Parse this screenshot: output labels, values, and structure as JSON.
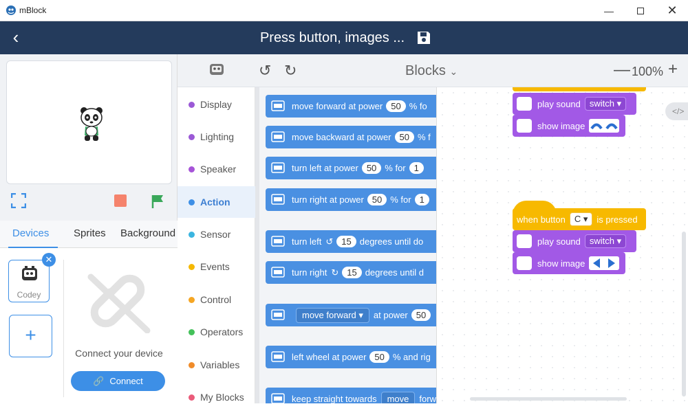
{
  "window": {
    "app_name": "mBlock"
  },
  "header": {
    "project_title": "Press button, images ..."
  },
  "stage_tabs": [
    "Devices",
    "Sprites",
    "Background"
  ],
  "device": {
    "name": "Codey"
  },
  "connect": {
    "prompt": "Connect your device",
    "button_label": "Connect"
  },
  "toolbar": {
    "mode_label": "Blocks",
    "zoom": "100%"
  },
  "categories": [
    {
      "label": "Display",
      "color": "#9b59d6"
    },
    {
      "label": "Lighting",
      "color": "#9b59d6"
    },
    {
      "label": "Speaker",
      "color": "#a654d8"
    },
    {
      "label": "Action",
      "color": "#3d8fe6",
      "active": true
    },
    {
      "label": "Sensor",
      "color": "#3bb5e0"
    },
    {
      "label": "Events",
      "color": "#f5b800"
    },
    {
      "label": "Control",
      "color": "#f5a623"
    },
    {
      "label": "Operators",
      "color": "#44c15a"
    },
    {
      "label": "Variables",
      "color": "#f08c2a"
    },
    {
      "label": "My Blocks",
      "color": "#ea5b7a"
    }
  ],
  "palette_blocks": {
    "b1": {
      "text": "move forward at power",
      "value": "50",
      "tail": "% fo"
    },
    "b2": {
      "text": "move backward at power",
      "value": "50",
      "tail": "% f"
    },
    "b3": {
      "text": "turn left at power",
      "value": "50",
      "mid": "% for",
      "value2": "1"
    },
    "b4": {
      "text": "turn right at power",
      "value": "50",
      "mid": "% for",
      "value2": "1"
    },
    "b5": {
      "text": "turn left",
      "arrow": "↺",
      "value": "15",
      "tail": "degrees until do"
    },
    "b6": {
      "text": "turn right",
      "arrow": "↻",
      "value": "15",
      "tail": "degrees until d"
    },
    "b7": {
      "dropdown": "move forward",
      "text": "at power",
      "value": "50"
    },
    "b8": {
      "text": "left wheel at power",
      "value": "50",
      "tail": "% and rig"
    },
    "b9": {
      "text": "keep straight towards",
      "dropdown": "move",
      "tail": "forw"
    }
  },
  "script1": {
    "play_label": "play sound",
    "sound": "switch",
    "show_label": "show image"
  },
  "script2": {
    "hat_label": "when button",
    "button": "C",
    "hat_tail": "is pressed",
    "play_label": "play sound",
    "sound": "switch",
    "show_label": "show image"
  }
}
